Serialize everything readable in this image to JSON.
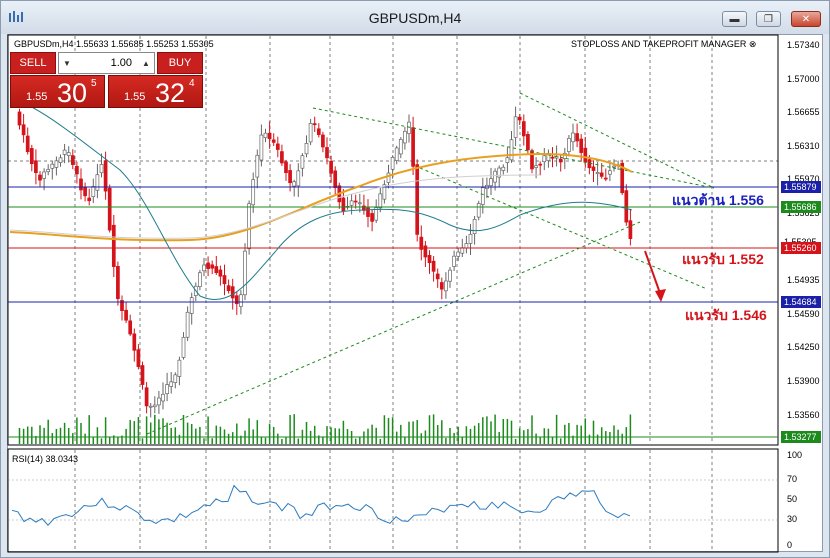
{
  "window": {
    "title": "GBPUSDm,H4",
    "minimize_glyph": "▬",
    "restore_glyph": "❐",
    "close_glyph": "✕"
  },
  "chart": {
    "symbol_info": "GBPUSDm,H4  1.55633 1.55685 1.55253 1.55305",
    "manager_label": "STOPLOSS AND TAKEPROFIT MANAGER ⊗",
    "price_axis": [
      "1.57340",
      "1.57000",
      "1.56655",
      "1.56310",
      "1.55970",
      "1.55625",
      "1.55280",
      "1.54935",
      "1.54590",
      "1.54250",
      "1.53900",
      "1.53560"
    ],
    "price_tags": {
      "resistance_blue": "1.55879",
      "ma_green": "1.55686",
      "current_price": "1.55305",
      "support_red": "1.55260",
      "support_blue_low": "1.54684",
      "volume_level": "1.53277"
    },
    "annotations": {
      "resistance": "แนวต้าน 1.556",
      "support_1": "แนวรับ 1.552",
      "support_2": "แนวรับ 1.546"
    },
    "rsi_label": "RSI(14) 38.0343",
    "rsi_axis": [
      "100",
      "70",
      "50",
      "30",
      "0"
    ],
    "colors": {
      "bull_candle": "#ffffff",
      "bear_candle": "#d4141a",
      "neutral_candle": "#888888",
      "ma_fast": "#1e7c8c",
      "ma_slow": "#e8a020",
      "resistance_line": "#1a20a8",
      "support_line": "#d4141a",
      "trend_line": "#1c8a1c",
      "rsi_line": "#2a7ac0",
      "annotation_blue": "#1a20c0",
      "annotation_red": "#d4141a"
    }
  },
  "trade_panel": {
    "sell_label": "SELL",
    "buy_label": "BUY",
    "lot_value": "1.00",
    "bid_small": "1.55",
    "bid_big": "30",
    "bid_sup": "5",
    "ask_small": "1.55",
    "ask_big": "32",
    "ask_sup": "4",
    "down_glyph": "▼",
    "up_glyph": "▲"
  }
}
